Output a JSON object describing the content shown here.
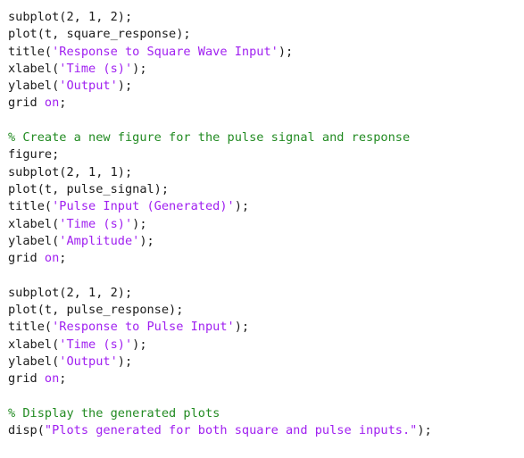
{
  "editor": {
    "lines": [
      [
        {
          "t": "plain",
          "text": "subplot(2, 1, 2);"
        }
      ],
      [
        {
          "t": "plain",
          "text": "plot(t, square_response);"
        }
      ],
      [
        {
          "t": "plain",
          "text": "title("
        },
        {
          "t": "string",
          "text": "'Response to Square Wave Input'"
        },
        {
          "t": "plain",
          "text": ");"
        }
      ],
      [
        {
          "t": "plain",
          "text": "xlabel("
        },
        {
          "t": "string",
          "text": "'Time (s)'"
        },
        {
          "t": "plain",
          "text": ");"
        }
      ],
      [
        {
          "t": "plain",
          "text": "ylabel("
        },
        {
          "t": "string",
          "text": "'Output'"
        },
        {
          "t": "plain",
          "text": ");"
        }
      ],
      [
        {
          "t": "plain",
          "text": "grid "
        },
        {
          "t": "keyword",
          "text": "on"
        },
        {
          "t": "plain",
          "text": ";"
        }
      ],
      [],
      [
        {
          "t": "comment",
          "text": "% Create a new figure for the pulse signal and response"
        }
      ],
      [
        {
          "t": "plain",
          "text": "figure;"
        }
      ],
      [
        {
          "t": "plain",
          "text": "subplot(2, 1, 1);"
        }
      ],
      [
        {
          "t": "plain",
          "text": "plot(t, pulse_signal);"
        }
      ],
      [
        {
          "t": "plain",
          "text": "title("
        },
        {
          "t": "string",
          "text": "'Pulse Input (Generated)'"
        },
        {
          "t": "plain",
          "text": ");"
        }
      ],
      [
        {
          "t": "plain",
          "text": "xlabel("
        },
        {
          "t": "string",
          "text": "'Time (s)'"
        },
        {
          "t": "plain",
          "text": ");"
        }
      ],
      [
        {
          "t": "plain",
          "text": "ylabel("
        },
        {
          "t": "string",
          "text": "'Amplitude'"
        },
        {
          "t": "plain",
          "text": ");"
        }
      ],
      [
        {
          "t": "plain",
          "text": "grid "
        },
        {
          "t": "keyword",
          "text": "on"
        },
        {
          "t": "plain",
          "text": ";"
        }
      ],
      [],
      [
        {
          "t": "plain",
          "text": "subplot(2, 1, 2);"
        }
      ],
      [
        {
          "t": "plain",
          "text": "plot(t, pulse_response);"
        }
      ],
      [
        {
          "t": "plain",
          "text": "title("
        },
        {
          "t": "string",
          "text": "'Response to Pulse Input'"
        },
        {
          "t": "plain",
          "text": ");"
        }
      ],
      [
        {
          "t": "plain",
          "text": "xlabel("
        },
        {
          "t": "string",
          "text": "'Time (s)'"
        },
        {
          "t": "plain",
          "text": ");"
        }
      ],
      [
        {
          "t": "plain",
          "text": "ylabel("
        },
        {
          "t": "string",
          "text": "'Output'"
        },
        {
          "t": "plain",
          "text": ");"
        }
      ],
      [
        {
          "t": "plain",
          "text": "grid "
        },
        {
          "t": "keyword",
          "text": "on"
        },
        {
          "t": "plain",
          "text": ";"
        }
      ],
      [],
      [
        {
          "t": "comment",
          "text": "% Display the generated plots"
        }
      ],
      [
        {
          "t": "plain",
          "text": "disp("
        },
        {
          "t": "string",
          "text": "\"Plots generated for both square and pulse inputs.\""
        },
        {
          "t": "plain",
          "text": ");"
        }
      ]
    ]
  },
  "colors": {
    "plain": "#1a1a1a",
    "string": "#a020f0",
    "keyword": "#a020f0",
    "comment": "#228b22",
    "background": "#ffffff"
  }
}
